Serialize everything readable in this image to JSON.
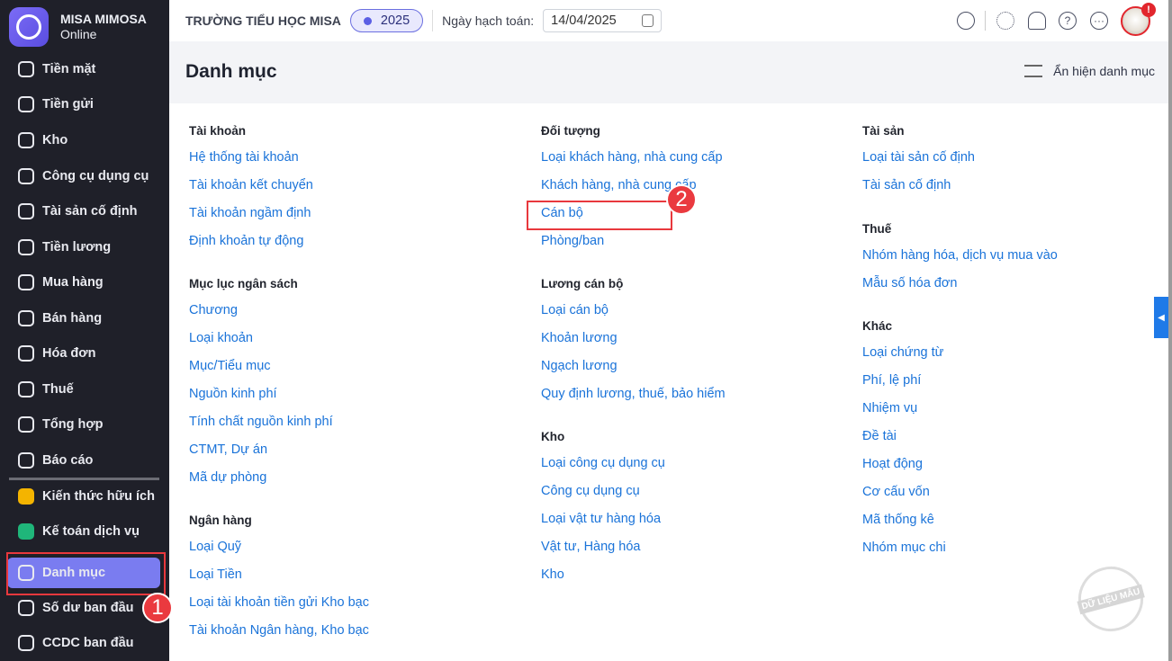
{
  "brand": {
    "name": "MISA MIMOSA",
    "sub": "Online"
  },
  "sidebar": {
    "items": [
      {
        "label": "Tiền mặt"
      },
      {
        "label": "Tiền gửi"
      },
      {
        "label": "Kho"
      },
      {
        "label": "Công cụ dụng cụ"
      },
      {
        "label": "Tài sản cố định"
      },
      {
        "label": "Tiền lương"
      },
      {
        "label": "Mua hàng"
      },
      {
        "label": "Bán hàng"
      },
      {
        "label": "Hóa đơn"
      },
      {
        "label": "Thuế"
      },
      {
        "label": "Tổng hợp"
      },
      {
        "label": "Báo cáo"
      },
      {
        "label": "Kiến thức hữu ích"
      },
      {
        "label": "Kế toán dịch vụ"
      },
      {
        "label": "Danh mục"
      },
      {
        "label": "Số dư ban đầu"
      },
      {
        "label": "CCDC ban đầu"
      }
    ],
    "active": "Danh mục"
  },
  "topbar": {
    "school": "TRƯỜNG TIỂU HỌC MISA",
    "year": "2025",
    "date_label": "Ngày hạch toán:",
    "date": "14/04/2025"
  },
  "header": {
    "title": "Danh mục",
    "toggle": "Ẩn hiện danh mục"
  },
  "callouts": [
    "1",
    "2"
  ],
  "avatar_alert": "!",
  "groups": [
    {
      "title": "Tài khoản",
      "links": [
        "Hệ thống tài khoản",
        "Tài khoản kết chuyển",
        "Tài khoản ngầm định",
        "Định khoản tự động"
      ]
    },
    {
      "title": "Mục lục ngân sách",
      "links": [
        "Chương",
        "Loại khoản",
        "Mục/Tiểu mục",
        "Nguồn kinh phí",
        "Tính chất nguồn kinh phí",
        "CTMT, Dự án",
        "Mã dự phòng"
      ]
    },
    {
      "title": "Ngân hàng",
      "links": [
        "Loại Quỹ",
        "Loại Tiền",
        "Loại tài khoản tiền gửi Kho bạc",
        "Tài khoản Ngân hàng, Kho bạc"
      ]
    },
    {
      "title": "Đối tượng",
      "links": [
        "Loại khách hàng, nhà cung cấp",
        "Khách hàng, nhà cung cấp",
        "Cán bộ",
        "Phòng/ban"
      ]
    },
    {
      "title": "Lương cán bộ",
      "links": [
        "Loại cán bộ",
        "Khoản lương",
        "Ngạch lương",
        "Quy định lương, thuế, bảo hiểm"
      ]
    },
    {
      "title": "Kho",
      "links": [
        "Loại công cụ dụng cụ",
        "Công cụ dụng cụ",
        "Loại vật tư hàng hóa",
        "Vật tư, Hàng hóa",
        "Kho"
      ]
    },
    {
      "title": "Tài sản",
      "links": [
        "Loại tài sản cố định",
        "Tài sản cố định"
      ]
    },
    {
      "title": "Thuế",
      "links": [
        "Nhóm hàng hóa, dịch vụ mua vào",
        "Mẫu số hóa đơn"
      ]
    },
    {
      "title": "Khác",
      "links": [
        "Loại chứng từ",
        "Phí, lệ phí",
        "Nhiệm vụ",
        "Đề tài",
        "Hoạt động",
        "Cơ cấu vốn",
        "Mã thống kê",
        "Nhóm mục chi"
      ]
    }
  ],
  "watermark": "DỮ LIỆU MẪU"
}
